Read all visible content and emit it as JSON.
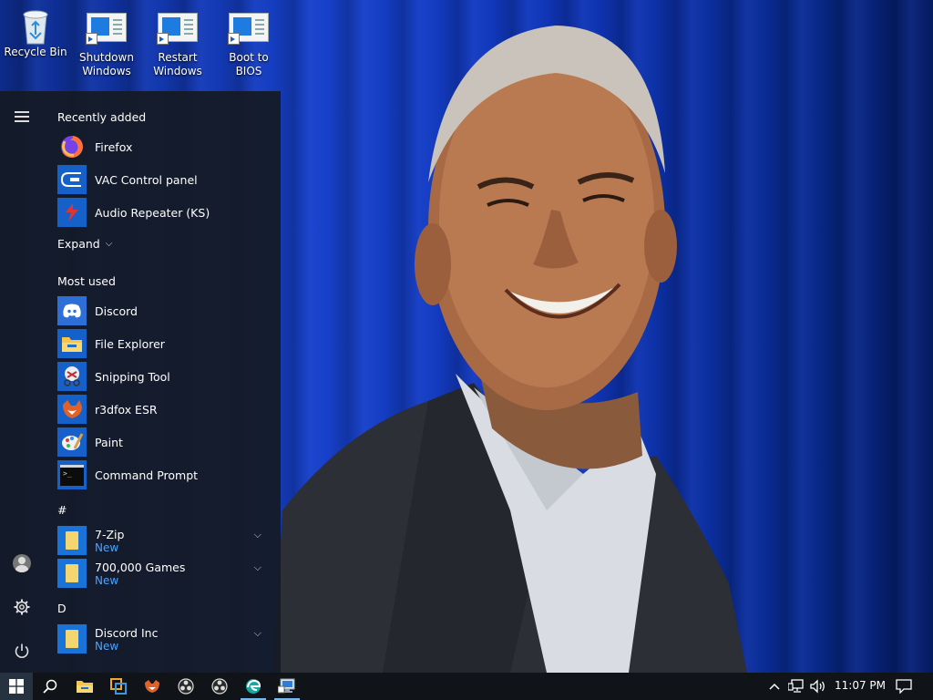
{
  "desktop": {
    "icons": [
      {
        "label": "Recycle Bin"
      },
      {
        "label": "Shutdown Windows"
      },
      {
        "label": "Restart Windows"
      },
      {
        "label": "Boot to BIOS"
      }
    ]
  },
  "start_menu": {
    "recently_added_header": "Recently added",
    "recent_apps": [
      {
        "label": "Firefox",
        "icon": "firefox-icon"
      },
      {
        "label": "VAC Control panel",
        "icon": "vac-icon"
      },
      {
        "label": "Audio Repeater (KS)",
        "icon": "audio-repeater-icon"
      }
    ],
    "expand_label": "Expand",
    "most_used_header": "Most used",
    "most_used_apps": [
      {
        "label": "Discord",
        "icon": "discord-icon"
      },
      {
        "label": "File Explorer",
        "icon": "file-explorer-icon"
      },
      {
        "label": "Snipping Tool",
        "icon": "snipping-tool-icon"
      },
      {
        "label": "r3dfox ESR",
        "icon": "r3dfox-icon"
      },
      {
        "label": "Paint",
        "icon": "paint-icon"
      },
      {
        "label": "Command Prompt",
        "icon": "command-prompt-icon"
      }
    ],
    "hash_header": "#",
    "hash_apps": [
      {
        "label": "7-Zip",
        "badge": "New"
      },
      {
        "label": "700,000 Games",
        "badge": "New"
      }
    ],
    "d_header": "D",
    "d_apps": [
      {
        "label": "Discord Inc",
        "badge": "New"
      }
    ]
  },
  "taskbar": {
    "clock": "11:07 PM",
    "pinned": [
      "start-icon",
      "search-icon",
      "file-explorer-icon",
      "vmware-icon",
      "firefox-fox-icon",
      "obs-icon",
      "obs-icon",
      "edge-icon",
      "remote-desktop-icon"
    ]
  },
  "colors": {
    "accent_link": "#4aa3ff",
    "taskbar": "#101317",
    "menu": "#141a24"
  }
}
